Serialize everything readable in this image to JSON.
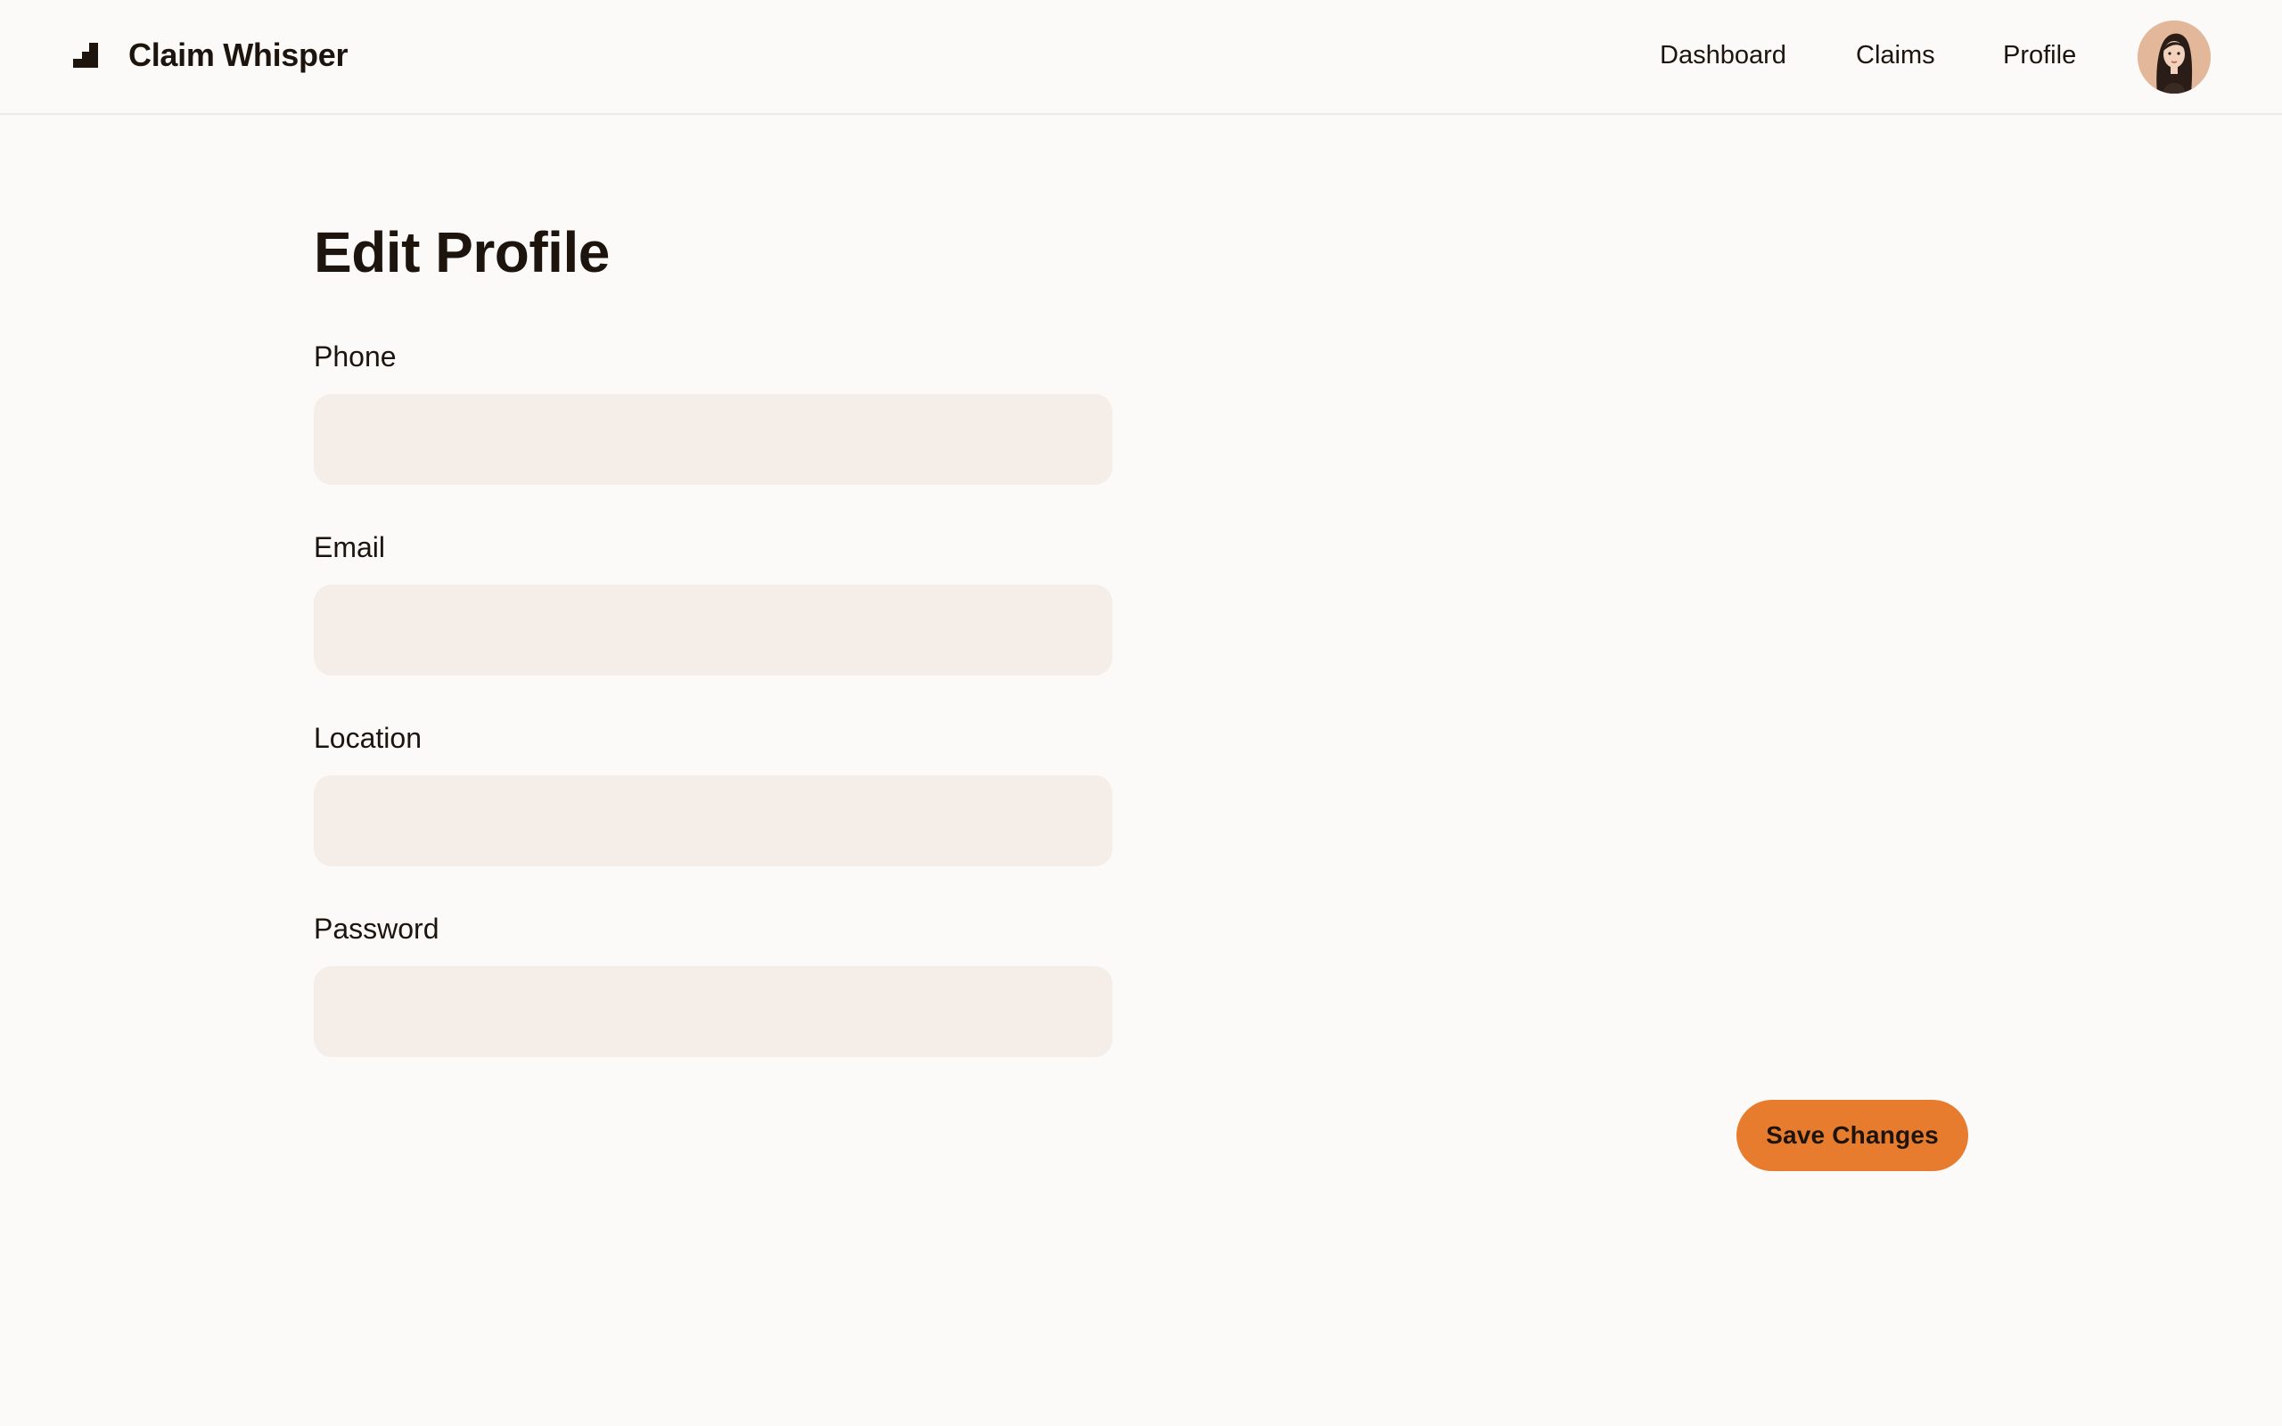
{
  "header": {
    "brand": "Claim Whisper",
    "logo_icon": "stairs-logo-icon",
    "nav": [
      {
        "label": "Dashboard"
      },
      {
        "label": "Claims"
      },
      {
        "label": "Profile"
      }
    ],
    "avatar_icon": "user-avatar"
  },
  "main": {
    "title": "Edit Profile",
    "fields": [
      {
        "label": "Phone",
        "value": "",
        "placeholder": ""
      },
      {
        "label": "Email",
        "value": "",
        "placeholder": ""
      },
      {
        "label": "Location",
        "value": "",
        "placeholder": ""
      },
      {
        "label": "Password",
        "value": "",
        "placeholder": ""
      }
    ],
    "save_label": "Save Changes"
  },
  "colors": {
    "accent": "#e87c2e",
    "input_bg": "#f4ede8",
    "page_bg": "#fbfaf8",
    "text": "#1c140d"
  }
}
